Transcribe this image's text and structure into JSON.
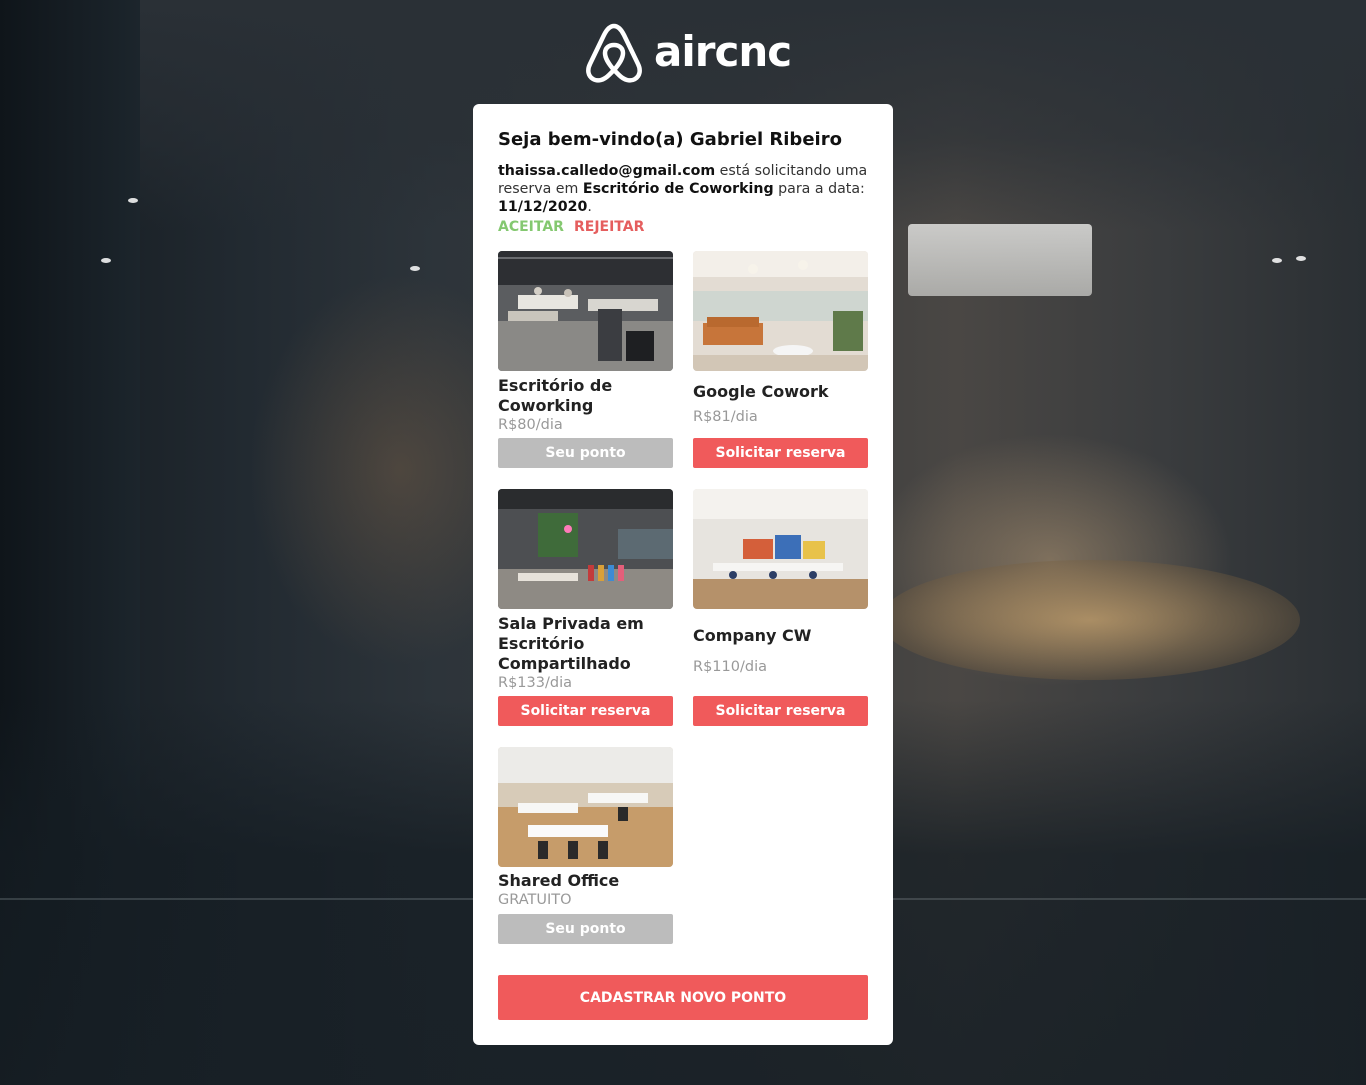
{
  "brand": {
    "name": "aircnc",
    "logo_icon": "airbnb-belo-icon"
  },
  "dashboard": {
    "welcome": "Seja bem-vindo(a) Gabriel Ribeiro",
    "request": {
      "email": "thaissa.calledo@gmail.com",
      "text_1": " está solicitando uma reserva em ",
      "spot": "Escritório de Coworking",
      "text_2": " para a data: ",
      "date": "11/12/2020",
      "text_3": "."
    },
    "accept_label": "ACEITAR",
    "reject_label": "REJEITAR",
    "spots": [
      {
        "title": "Escritório de Coworking",
        "price": "R$80/dia",
        "button": "Seu ponto",
        "button_style": "gray"
      },
      {
        "title": "Google Cowork",
        "price": "R$81/dia",
        "button": "Solicitar reserva",
        "button_style": "red"
      },
      {
        "title": "Sala Privada em Escritório Compartilhado",
        "price": "R$133/dia",
        "button": "Solicitar reserva",
        "button_style": "red"
      },
      {
        "title": "Company CW",
        "price": "R$110/dia",
        "button": "Solicitar reserva",
        "button_style": "red"
      },
      {
        "title": "Shared Office",
        "price": "GRATUITO",
        "button": "Seu ponto",
        "button_style": "gray"
      }
    ],
    "new_spot_button": "CADASTRAR NOVO PONTO"
  },
  "colors": {
    "accent": "#f05a5b",
    "accept": "#84c870",
    "reject": "#e55e5e",
    "disabled": "#bcbcbc"
  }
}
